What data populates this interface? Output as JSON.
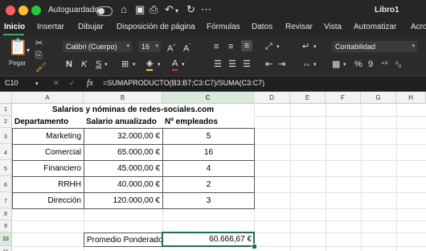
{
  "titlebar": {
    "autosave_label": "Autoguardado",
    "workbook_title": "Libro1",
    "icons": [
      "home-icon",
      "save-icon",
      "print-icon",
      "undo-icon",
      "redo-icon",
      "more-icon"
    ]
  },
  "tabs": [
    "Inicio",
    "Insertar",
    "Dibujar",
    "Disposición de página",
    "Fórmulas",
    "Datos",
    "Revisar",
    "Vista",
    "Automatizar",
    "Acro"
  ],
  "active_tab": "Inicio",
  "ribbon": {
    "paste_label": "Pegar",
    "font_name": "Calibri (Cuerpo)",
    "font_size": "16",
    "bold": "N",
    "italic": "K",
    "underline": "S",
    "number_format": "Contabilidad",
    "percent": "%",
    "thousands": "9"
  },
  "formula_bar": {
    "cell_ref": "C10",
    "fx_label": "fx",
    "formula": "=SUMAPRODUCTO(B3:B7;C3:C7)/SUMA(C3:C7)"
  },
  "sheet": {
    "columns": [
      "A",
      "B",
      "C",
      "D",
      "E",
      "F",
      "G",
      "H"
    ],
    "rows": [
      "1",
      "2",
      "3",
      "4",
      "5",
      "6",
      "7",
      "8",
      "9",
      "10",
      "11"
    ],
    "title": "Salarios y nóminas de redes-sociales.com",
    "headers": [
      "Departamento",
      "Salario anualizado",
      "Nº empleados"
    ],
    "data": [
      {
        "dept": "Marketing",
        "salary": "32.000,00 €",
        "employees": "5"
      },
      {
        "dept": "Comercial",
        "salary": "65.000,00 €",
        "employees": "16"
      },
      {
        "dept": "Financiero",
        "salary": "45.000,00 €",
        "employees": "4"
      },
      {
        "dept": "RRHH",
        "salary": "40.000,00 €",
        "employees": "2"
      },
      {
        "dept": "Dirección",
        "salary": "120.000,00 €",
        "employees": "3"
      }
    ],
    "weighted_label": "Promedio Ponderado",
    "weighted_value": "60.666,67 €",
    "selected_cell": "C10"
  },
  "colors": {
    "accent": "#1e7145",
    "close": "#ff5f57",
    "minimize": "#febc2e",
    "maximize": "#28c840"
  }
}
